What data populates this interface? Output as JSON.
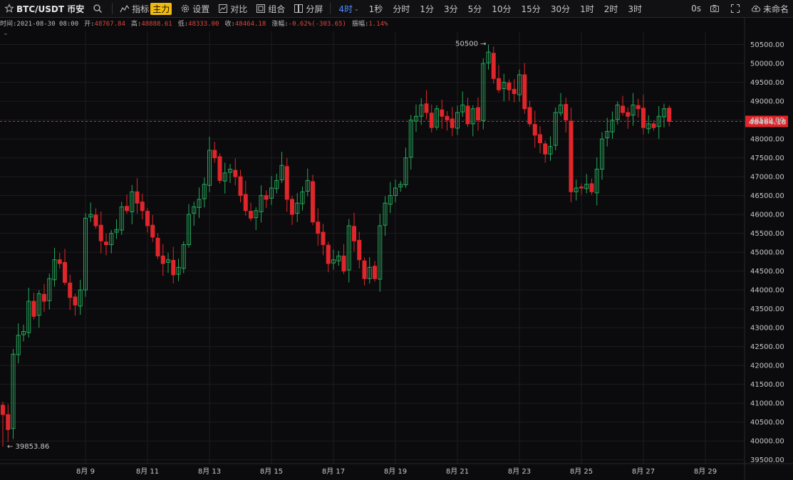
{
  "toolbar": {
    "symbol": "BTC/USDT 币安",
    "indicators_label": "指标",
    "main_badge": "主力",
    "settings_label": "设置",
    "compare_label": "对比",
    "combo_label": "组合",
    "split_label": "分屏",
    "active_interval": "4时",
    "intervals": [
      "1秒",
      "分时",
      "1分",
      "3分",
      "5分",
      "10分",
      "15分",
      "30分",
      "1时",
      "2时",
      "3时"
    ],
    "countdown": "0s",
    "layout_name": "未命名"
  },
  "info": {
    "time_label": "时间:",
    "time_value": "2021-08-30 08:00",
    "open_label": "开:",
    "open_value": "48767.84",
    "high_label": "高:",
    "high_value": "48888.61",
    "low_label": "低:",
    "low_value": "48333.00",
    "close_label": "收:",
    "close_value": "48464.18",
    "change_label": "涨幅:",
    "change_value": "-0.62%(-303.65)",
    "amp_label": "振幅:",
    "amp_value": "1.14%"
  },
  "colors": {
    "up": "#26a65b",
    "down": "#e0262b",
    "grid": "#1c1c20",
    "bg": "#0b0b0d"
  },
  "chart_data": {
    "type": "candlestick",
    "ylim": [
      39400,
      50850
    ],
    "y_ticks": [
      39500,
      40000,
      40500,
      41000,
      41500,
      42000,
      42500,
      43000,
      43500,
      44000,
      44500,
      45000,
      45500,
      46000,
      46500,
      47000,
      47500,
      48000,
      48500,
      49000,
      49500,
      50000,
      50500
    ],
    "x_ticks": [
      {
        "label": "8月 9",
        "index": 16
      },
      {
        "label": "8月 11",
        "index": 28
      },
      {
        "label": "8月 13",
        "index": 40
      },
      {
        "label": "8月 15",
        "index": 52
      },
      {
        "label": "8月 17",
        "index": 64
      },
      {
        "label": "8月 19",
        "index": 76
      },
      {
        "label": "8月 21",
        "index": 88
      },
      {
        "label": "8月 23",
        "index": 100
      },
      {
        "label": "8月 25",
        "index": 112
      },
      {
        "label": "8月 27",
        "index": 124
      },
      {
        "label": "8月 29",
        "index": 136
      }
    ],
    "last_price": 48464.18,
    "last_price_label": "48464.18",
    "high_marker_label": "50500",
    "low_marker_label": "39853.86",
    "closes": [
      40700,
      40300,
      42300,
      42800,
      42900,
      43700,
      43300,
      43900,
      43700,
      44300,
      44800,
      44700,
      44200,
      43800,
      43600,
      44000,
      45900,
      46000,
      45700,
      45300,
      45200,
      45500,
      45600,
      46200,
      46100,
      46600,
      46300,
      46100,
      45700,
      45400,
      44900,
      44700,
      44800,
      44400,
      44600,
      45200,
      46000,
      46200,
      46400,
      46800,
      47700,
      47500,
      46900,
      47100,
      47200,
      47000,
      46500,
      46100,
      45900,
      46100,
      46500,
      46400,
      46700,
      46900,
      47300,
      46400,
      46000,
      46300,
      46600,
      46900,
      45800,
      45500,
      45200,
      44700,
      44800,
      44900,
      44500,
      45700,
      45300,
      44800,
      44300,
      44600,
      44300,
      45700,
      46300,
      46500,
      46700,
      46800,
      47500,
      48500,
      48600,
      48900,
      48700,
      48300,
      48800,
      48600,
      48500,
      48300,
      48700,
      48900,
      48400,
      48800,
      48500,
      50000,
      50300,
      49600,
      49300,
      49500,
      49300,
      49200,
      49700,
      48800,
      48400,
      48100,
      47900,
      47600,
      47800,
      48700,
      48900,
      48500,
      46600,
      46700,
      46700,
      46800,
      46600,
      47200,
      48000,
      48200,
      48500,
      48900,
      48700,
      48600,
      48900,
      48800,
      48300,
      48400,
      48300,
      48600,
      48800,
      48464
    ]
  }
}
